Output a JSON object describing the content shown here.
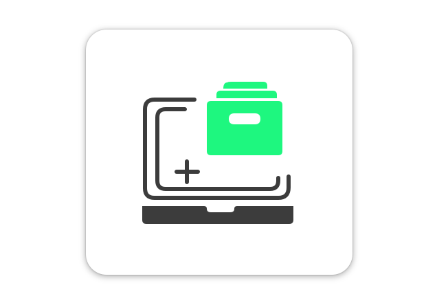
{
  "icon": {
    "name": "laptop-archive-add-icon",
    "colors": {
      "dark": "#3c3c3c",
      "accent": "#1ef77f",
      "card": "#ffffff",
      "background": "#ffffff"
    }
  }
}
